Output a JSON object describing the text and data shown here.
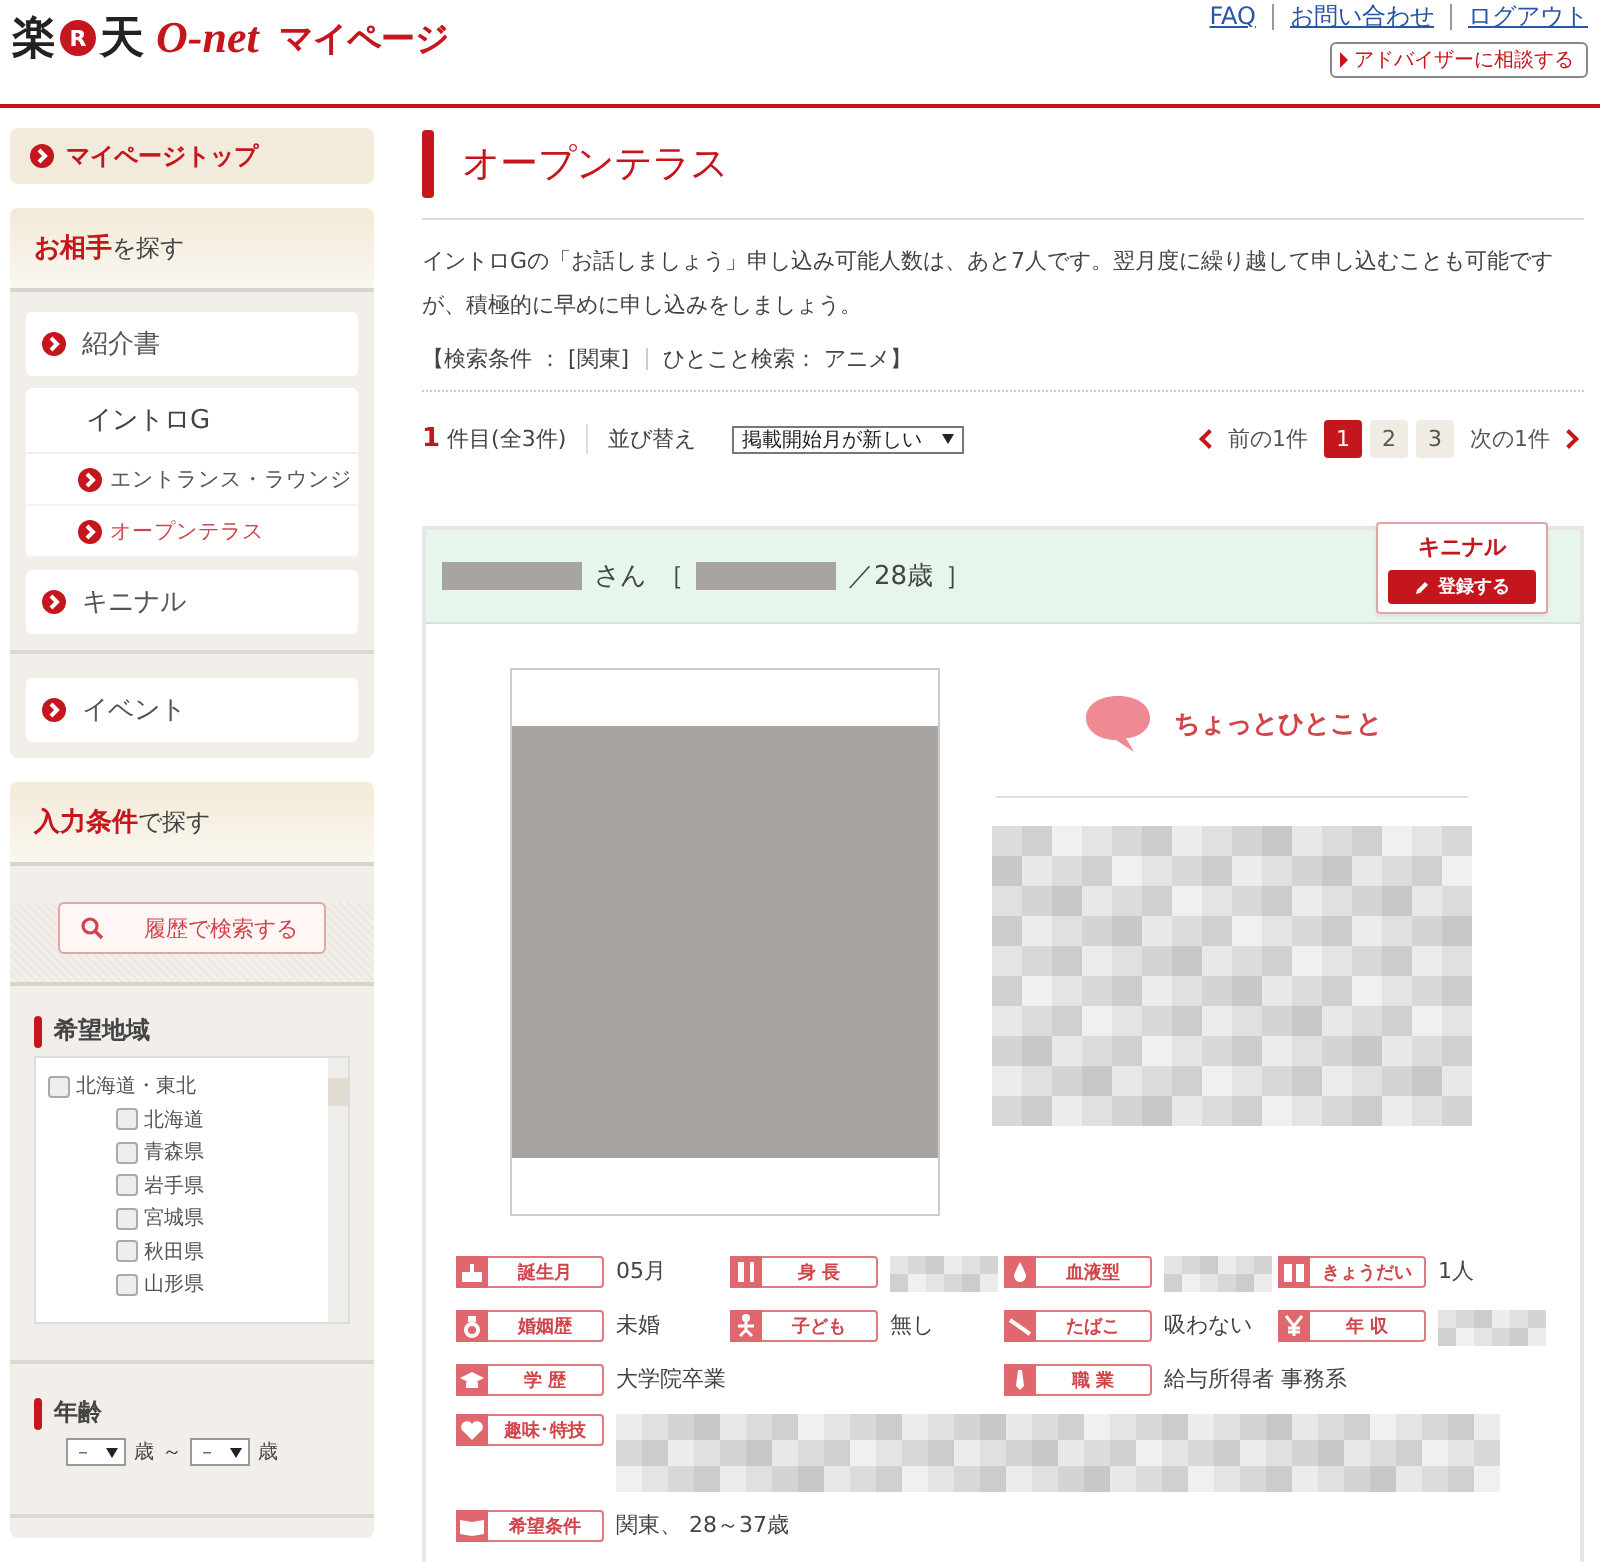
{
  "header": {
    "logo": {
      "brand_left": "楽",
      "mark": "R",
      "brand_right": "天",
      "product": "O-net",
      "section": "マイページ"
    },
    "links": [
      "FAQ",
      "お問い合わせ",
      "ログアウト"
    ],
    "advisor_button": "アドバイザーに相談する"
  },
  "sidebar": {
    "top_link": "マイページトップ",
    "partner": {
      "title_strong": "お相手",
      "title_rest": "を探す",
      "items": [
        {
          "kind": "link",
          "label": "紹介書"
        },
        {
          "kind": "group",
          "label": "イントロG",
          "children": [
            {
              "label": "エントランス・ラウンジ",
              "selected": false
            },
            {
              "label": "オープンテラス",
              "selected": true
            }
          ]
        },
        {
          "kind": "link",
          "label": "キニナル"
        }
      ],
      "event": "イベント"
    },
    "conditions": {
      "title_strong": "入力条件",
      "title_rest": "で探す",
      "history_button": "履歴で検索する",
      "region": {
        "title": "希望地域",
        "items": [
          {
            "label": "北海道・東北",
            "checked": false,
            "children": [
              {
                "label": "北海道",
                "checked": false
              },
              {
                "label": "青森県",
                "checked": false
              },
              {
                "label": "岩手県",
                "checked": false
              },
              {
                "label": "宮城県",
                "checked": false
              },
              {
                "label": "秋田県",
                "checked": false
              },
              {
                "label": "山形県",
                "checked": false
              }
            ]
          }
        ]
      },
      "age": {
        "title": "年齢",
        "from": "－",
        "to": "－",
        "unit_from": "歳",
        "separator": "～",
        "unit_to": "歳"
      }
    }
  },
  "main": {
    "title": "オープンテラス",
    "notice": "イントロGの「お話しましょう」申し込み可能人数は、あと7人です。翌月度に繰り越して申し込むことも可能ですが、積極的に早めに申し込みをしましょう。",
    "search_conditions": [
      "【検索条件 ： [関東]",
      "ひとこと検索： アニメ】"
    ],
    "result": {
      "current": "1",
      "count_text": "件目(全3件)",
      "sort_label": "並び替え",
      "sort_value": "掲載開始月が新しい"
    },
    "pager": {
      "prev": "前の1件",
      "pages": [
        {
          "label": "1",
          "selected": true
        },
        {
          "label": "2",
          "selected": false
        },
        {
          "label": "3",
          "selected": false
        }
      ],
      "next": "次の1件"
    },
    "card": {
      "name_suffix": "さん",
      "open_bracket": "［",
      "age": "／28歳",
      "close_bracket": "］",
      "badge": {
        "title": "キニナル",
        "button": "登録する"
      },
      "comment_title": "ちょっとひとこと",
      "fields": [
        {
          "label": "誕生月",
          "value": "05月",
          "kind": "short"
        },
        {
          "label": "身 長",
          "redacted": true,
          "kind": "short"
        },
        {
          "label": "血液型",
          "redacted": true,
          "kind": "short"
        },
        {
          "label": "きょうだい",
          "value": "1人",
          "kind": "short"
        },
        {
          "label": "婚姻歴",
          "value": "未婚",
          "kind": "short"
        },
        {
          "label": "子ども",
          "value": "無し",
          "kind": "short"
        },
        {
          "label": "たばこ",
          "value": "吸わない",
          "kind": "short"
        },
        {
          "label": "年 収",
          "redacted": true,
          "kind": "short"
        },
        {
          "label": "学 歴",
          "value": "大学院卒業",
          "kind": "wide"
        },
        {
          "label": "職 業",
          "value": "給与所得者 事務系",
          "kind": "wide"
        },
        {
          "label": "趣味･特技",
          "redacted": true,
          "kind": "full"
        },
        {
          "label": "希望条件",
          "value": "関東、 28～37歳",
          "kind": "full"
        }
      ]
    }
  }
}
